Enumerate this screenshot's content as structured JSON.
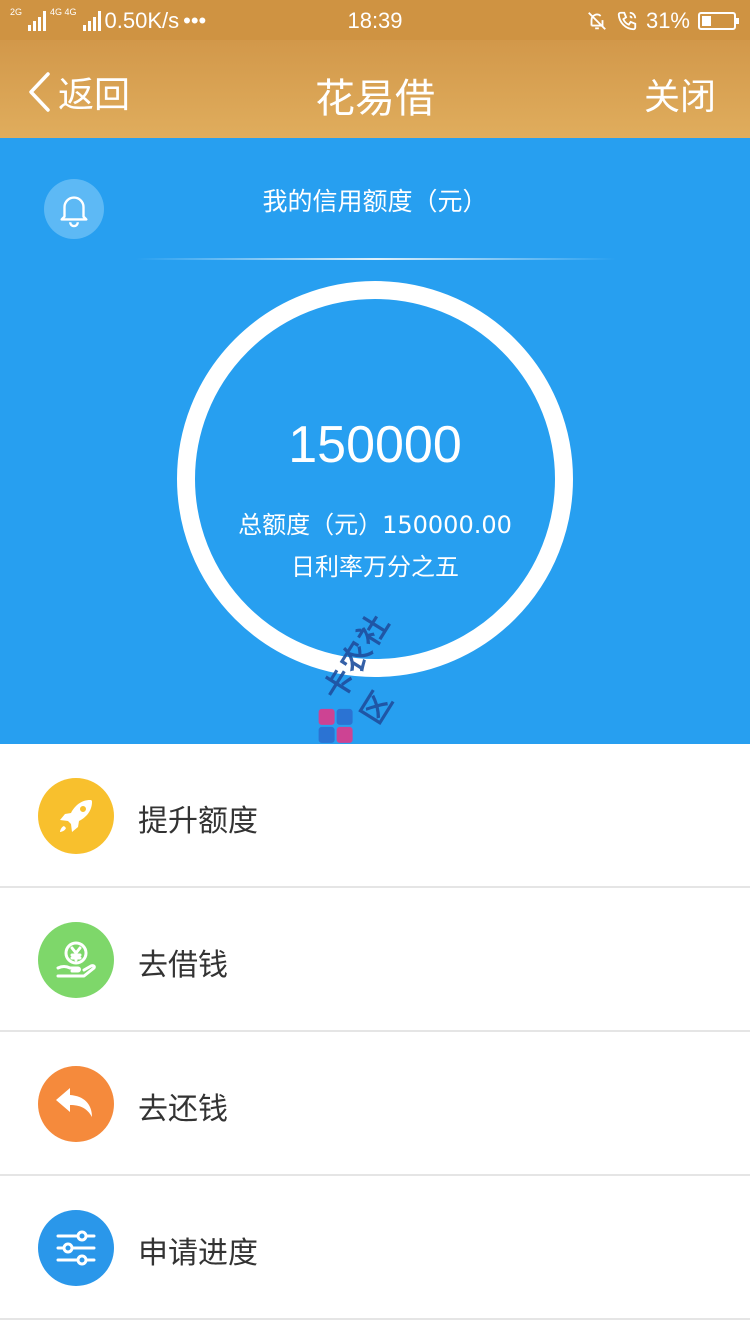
{
  "status_bar": {
    "network_left": "2G",
    "network_right": "4G 4G",
    "speed": "0.50K/s",
    "more": "•••",
    "time": "18:39",
    "battery": "31%",
    "battery_level": 0.31
  },
  "nav": {
    "back_label": "返回",
    "title": "花易借",
    "close_label": "关闭"
  },
  "credit": {
    "label": "我的信用额度（元）",
    "amount": "150000",
    "total": "总额度（元）150000.00",
    "rate": "日利率万分之五"
  },
  "watermark": {
    "text": "卡农社区"
  },
  "menu": [
    {
      "label": "提升额度",
      "icon": "rocket-icon",
      "color": "#f8c02d"
    },
    {
      "label": "去借钱",
      "icon": "money-hand-icon",
      "color": "#7ed76a"
    },
    {
      "label": "去还钱",
      "icon": "return-arrow-icon",
      "color": "#f58a3c"
    },
    {
      "label": "申请进度",
      "icon": "sliders-icon",
      "color": "#2a97ea"
    }
  ],
  "colors": {
    "header": "#d8a250",
    "panel": "#279ff0"
  }
}
